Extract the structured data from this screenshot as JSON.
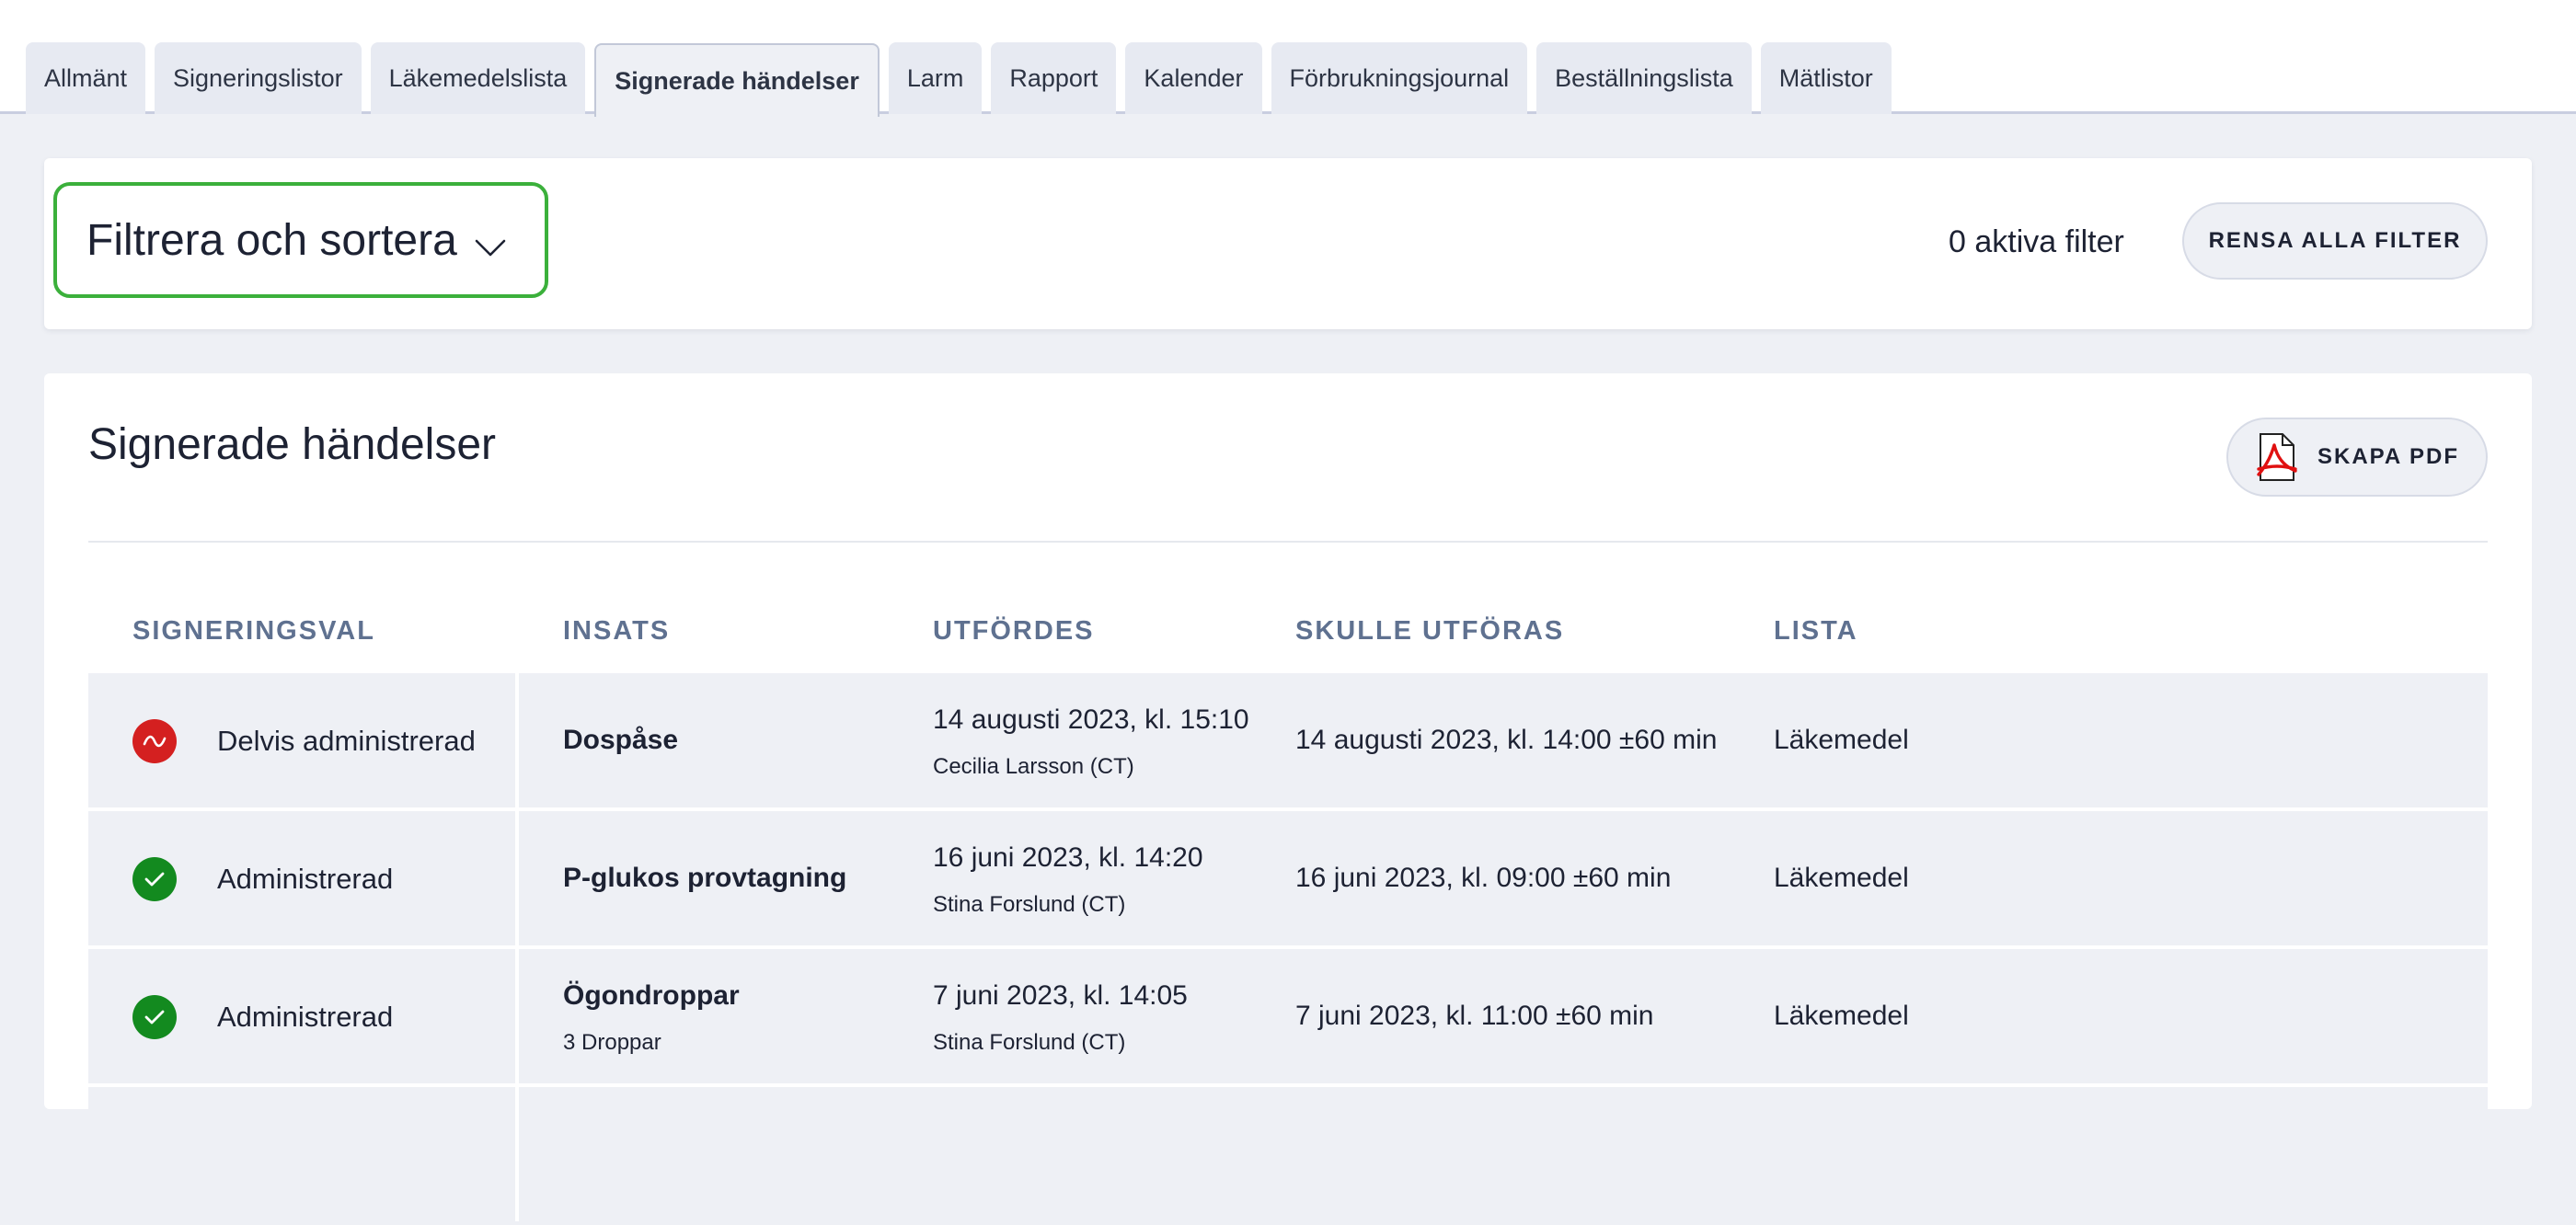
{
  "tabs": [
    {
      "label": "Allmänt"
    },
    {
      "label": "Signeringslistor"
    },
    {
      "label": "Läkemedelslista"
    },
    {
      "label": "Signerade händelser",
      "active": true
    },
    {
      "label": "Larm"
    },
    {
      "label": "Rapport"
    },
    {
      "label": "Kalender"
    },
    {
      "label": "Förbrukningsjournal"
    },
    {
      "label": "Beställningslista"
    },
    {
      "label": "Mätlistor"
    }
  ],
  "filter": {
    "toggle_label": "Filtrera och sortera",
    "active_filters_text": "0 aktiva filter",
    "clear_label": "RENSA ALLA FILTER",
    "accent_color": "#3bb03b"
  },
  "card": {
    "title": "Signerade händelser",
    "pdf_label": "SKAPA PDF",
    "pdf_icon": "pdf-file-icon"
  },
  "table": {
    "headers": {
      "signeringsval": "SIGNERINGSVAL",
      "insats": "INSATS",
      "utfordes": "UTFÖRDES",
      "skulle_utforas": "SKULLE UTFÖRAS",
      "lista": "LISTA"
    },
    "rows": [
      {
        "status": "Delvis administrerad",
        "status_kind": "partial",
        "status_icon": "tilde-icon",
        "status_color": "#d42020",
        "insats": "Dospåse",
        "insats_sub": "",
        "utfordes": "14 augusti 2023, kl. 15:10",
        "utfordes_by": "Cecilia Larsson (CT)",
        "skulle_utforas": "14 augusti 2023, kl. 14:00 ±60 min",
        "lista": "Läkemedel"
      },
      {
        "status": "Administrerad",
        "status_kind": "ok",
        "status_icon": "check-icon",
        "status_color": "#138a1f",
        "insats": "P-glukos provtagning",
        "insats_sub": "",
        "utfordes": "16 juni 2023, kl. 14:20",
        "utfordes_by": "Stina Forslund (CT)",
        "skulle_utforas": "16 juni 2023, kl. 09:00 ±60 min",
        "lista": "Läkemedel"
      },
      {
        "status": "Administrerad",
        "status_kind": "ok",
        "status_icon": "check-icon",
        "status_color": "#138a1f",
        "insats": "Ögondroppar",
        "insats_sub": "3 Droppar",
        "utfordes": "7 juni 2023, kl. 14:05",
        "utfordes_by": "Stina Forslund (CT)",
        "skulle_utforas": "7 juni 2023, kl. 11:00 ±60 min",
        "lista": "Läkemedel"
      }
    ]
  }
}
